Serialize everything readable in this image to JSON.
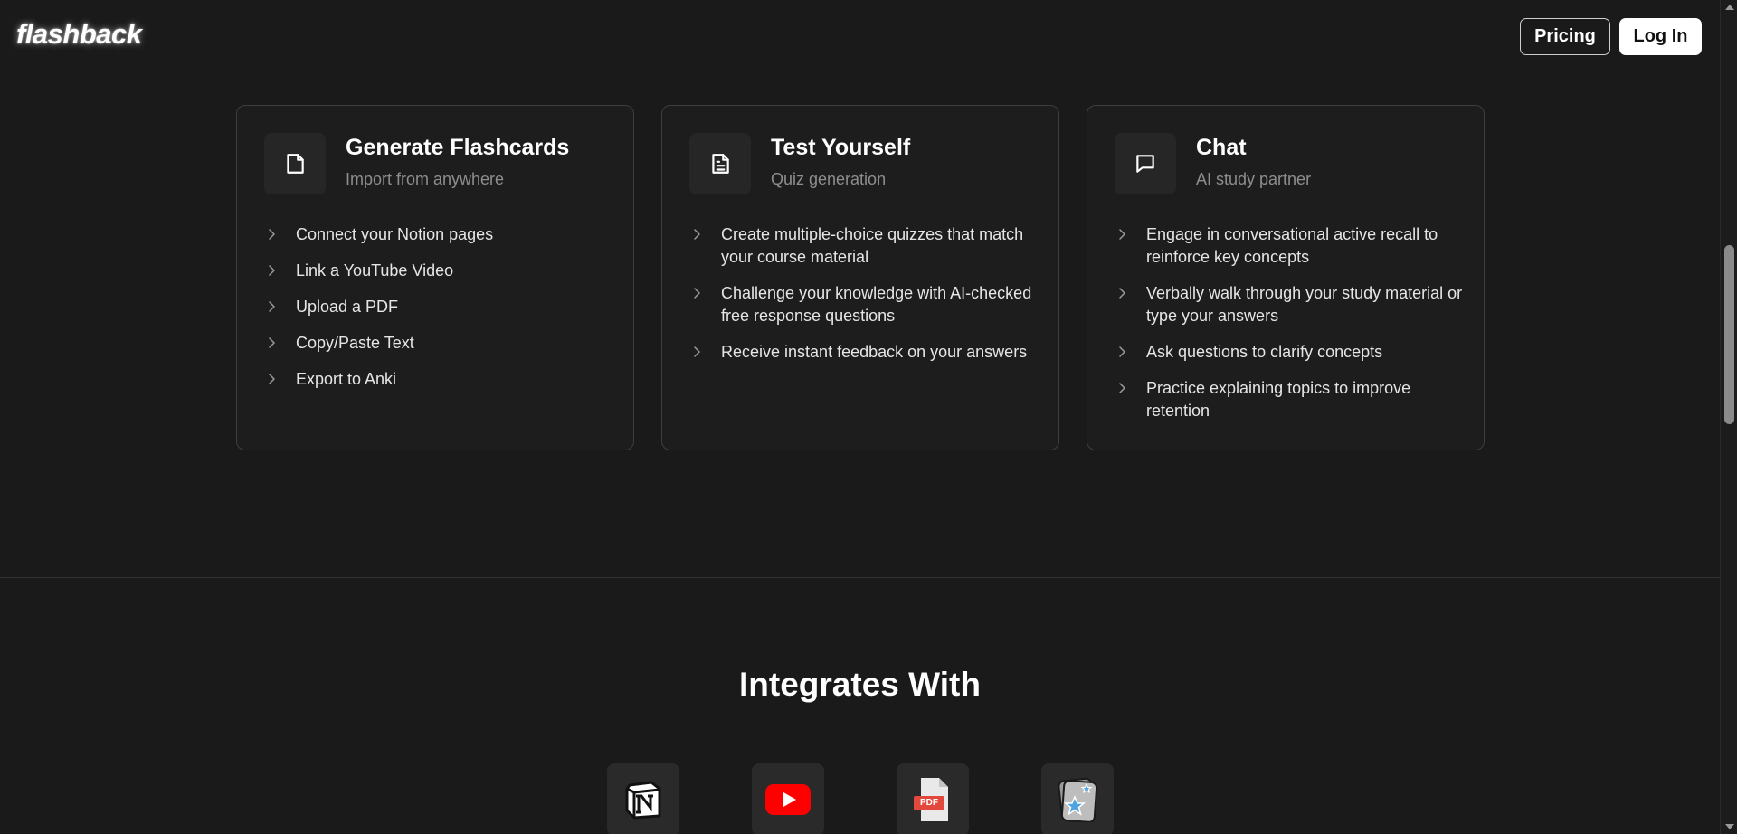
{
  "header": {
    "logo": "flashback",
    "pricing_label": "Pricing",
    "login_label": "Log In"
  },
  "cards": [
    {
      "title": "Generate Flashcards",
      "subtitle": "Import from anywhere",
      "icon": "file-icon",
      "items": [
        "Connect your Notion pages",
        "Link a YouTube Video",
        "Upload a PDF",
        "Copy/Paste Text",
        "Export to Anki"
      ]
    },
    {
      "title": "Test Yourself",
      "subtitle": "Quiz generation",
      "icon": "document-text-icon",
      "items": [
        "Create multiple-choice quizzes that match your course material",
        "Challenge your knowledge with AI-checked free response questions",
        "Receive instant feedback on your answers"
      ]
    },
    {
      "title": "Chat",
      "subtitle": "AI study partner",
      "icon": "chat-bubble-icon",
      "items": [
        "Engage in conversational active recall to reinforce key concepts",
        "Verbally walk through your study material or type your answers",
        "Ask questions to clarify concepts",
        "Practice explaining topics to improve retention"
      ]
    }
  ],
  "integrations": {
    "title": "Integrates With",
    "items": [
      {
        "name": "Notion",
        "icon": "notion-logo-icon"
      },
      {
        "name": "YouTube",
        "icon": "youtube-logo-icon"
      },
      {
        "name": "PDF",
        "icon": "pdf-file-icon",
        "label": "PDF"
      },
      {
        "name": "Anki",
        "icon": "anki-logo-icon"
      }
    ]
  },
  "colors": {
    "background": "#1a1a1a",
    "card_background": "#1d1d1d",
    "card_border": "#3e3e3e",
    "youtube_red": "#ff0000",
    "pdf_red": "#e2483b"
  }
}
